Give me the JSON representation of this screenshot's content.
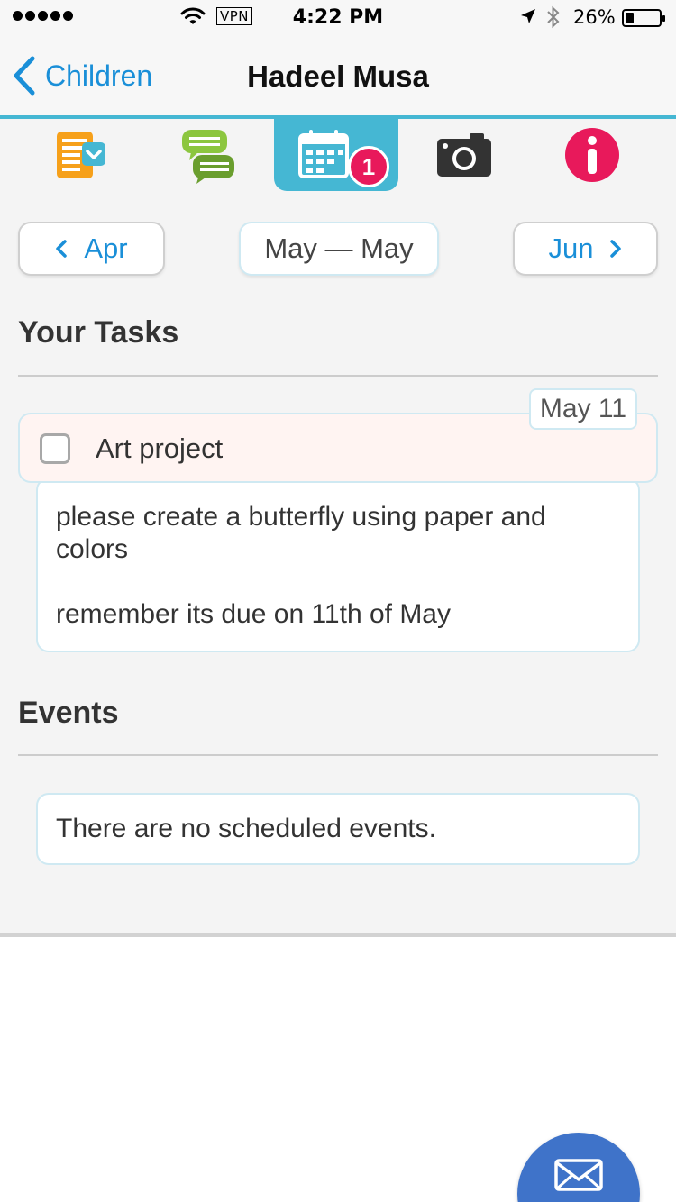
{
  "status_bar": {
    "vpn": "VPN",
    "time": "4:22 PM",
    "battery": "26%",
    "battery_level": 0.26
  },
  "nav": {
    "back_label": "Children",
    "title": "Hadeel Musa"
  },
  "tabs": [
    {
      "icon": "notes-icon",
      "active": false
    },
    {
      "icon": "chat-icon",
      "active": false
    },
    {
      "icon": "calendar-icon",
      "active": true,
      "badge": "1"
    },
    {
      "icon": "camera-icon",
      "active": false
    },
    {
      "icon": "info-icon",
      "active": false
    }
  ],
  "month_nav": {
    "prev": "Apr",
    "current": "May — May",
    "next": "Jun"
  },
  "tasks": {
    "title": "Your Tasks",
    "items": [
      {
        "date": "May 11",
        "title": "Art project",
        "checked": false,
        "body": [
          "please create a butterfly using paper and colors",
          "remember its due on 11th of May"
        ]
      }
    ]
  },
  "events": {
    "title": "Events",
    "empty_text": "There are no scheduled events."
  },
  "colors": {
    "accent": "#45b7d3",
    "link": "#1a8fd8",
    "badge": "#e8195b",
    "fab": "#3f73c9",
    "task_bg": "#fff4f2"
  },
  "fab": {
    "icon": "envelope-icon"
  }
}
